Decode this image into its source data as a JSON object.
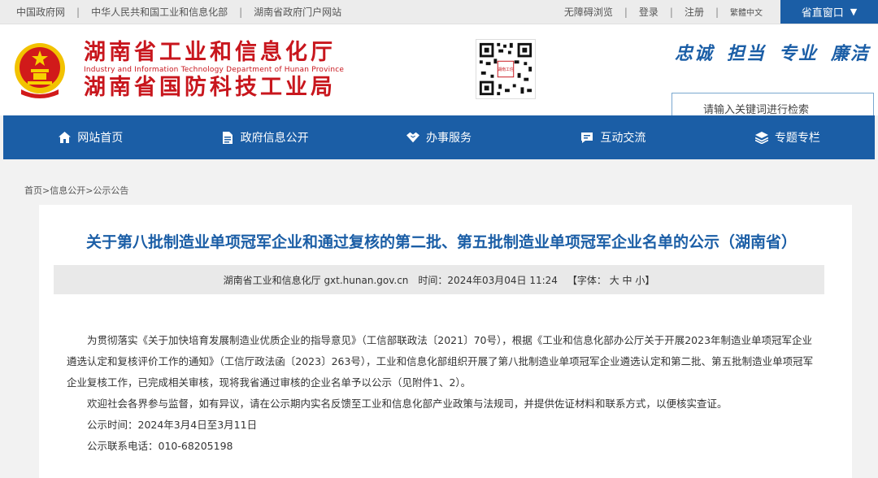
{
  "topbar": {
    "links": [
      "中国政府网",
      "中华人民共和国工业和信息化部",
      "湖南省政府门户网站"
    ],
    "accessibility": "无障碍浏览",
    "login": "登录",
    "register": "注册",
    "traditional": "繁體中文",
    "portal": "省直窗口",
    "portal_arrow": "▼"
  },
  "header": {
    "title_line1": "湖南省工业和信息化厅",
    "title_en": "Industry and Information Technology Department of Hunan Province",
    "title_line2": "湖南省国防科技工业局",
    "slogans": [
      "忠诚",
      "担当",
      "专业",
      "廉洁"
    ],
    "search_placeholder": "请输入关键词进行检索",
    "qr_label": "湖南工信"
  },
  "nav": [
    {
      "label": "网站首页",
      "icon": "home-icon"
    },
    {
      "label": "政府信息公开",
      "icon": "document-icon"
    },
    {
      "label": "办事服务",
      "icon": "handshake-icon"
    },
    {
      "label": "互动交流",
      "icon": "chat-icon"
    },
    {
      "label": "专题专栏",
      "icon": "layers-icon"
    }
  ],
  "breadcrumb": "首页>信息公开>公示公告",
  "article": {
    "title": "关于第八批制造业单项冠军企业和通过复核的第二批、第五批制造业单项冠军企业名单的公示（湖南省）",
    "meta_source": "湖南省工业和信息化厅 gxt.hunan.gov.cn",
    "meta_time": "时间：2024年03月04日 11:24",
    "meta_font": "【字体： 大 中 小】",
    "para1": "为贯彻落实《关于加快培育发展制造业优质企业的指导意见》（工信部联政法〔2021〕70号），根据《工业和信息化部办公厅关于开展2023年制造业单项冠军企业遴选认定和复核评价工作的通知》（工信厅政法函〔2023〕263号），工业和信息化部组织开展了第八批制造业单项冠军企业遴选认定和第二批、第五批制造业单项冠军企业复核工作，已完成相关审核，现将我省通过审核的企业名单予以公示（见附件1、2）。",
    "para2": "欢迎社会各界参与监督，如有异议，请在公示期内实名反馈至工业和信息化部产业政策与法规司，并提供佐证材料和联系方式，以便核实查证。",
    "para3": "公示时间：2024年3月4日至3月11日",
    "para4": "公示联系电话：010-68205198"
  }
}
